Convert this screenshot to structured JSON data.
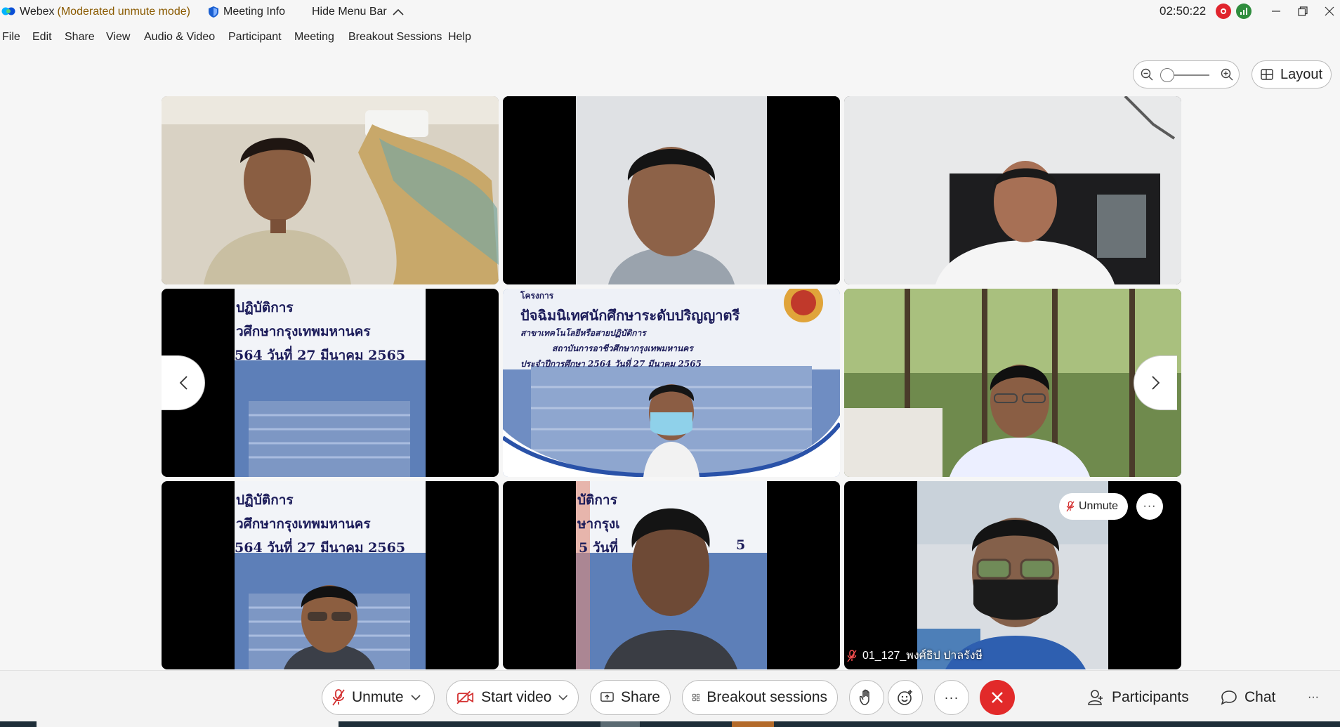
{
  "titlebar": {
    "app": "Webex",
    "mode": "(Moderated unmute mode)",
    "meeting_info": "Meeting Info",
    "hide_menu": "Hide Menu Bar",
    "time": "02:50:22"
  },
  "menu": [
    "File",
    "Edit",
    "Share",
    "View",
    "Audio & Video",
    "Participant",
    "Meeting",
    "Breakout Sessions",
    "Help"
  ],
  "view": {
    "layout_label": "Layout"
  },
  "tiles": {
    "t4_lines": [
      "ปฏิบัติการ",
      "วศึกษากรุงเทพมหานคร",
      "564 วันที่ 27 มีนาคม 2565"
    ],
    "t5_lines": [
      "โครงการ",
      "ปัจฉิมนิเทศนักศึกษาระดับปริญญาตรี",
      "สาขาเทคโนโลยีหรือสายปฏิบัติการ",
      "สถาบันการอาชีวศึกษากรุงเทพมหานคร",
      "ประจำปีการศึกษา 2564 วันที่ 27 มีนาคม 2565"
    ],
    "t7_lines": [
      "ปฏิบัติการ",
      "วศึกษากรุงเทพมหานคร",
      "564 วันที่ 27 มีนาคม 2565"
    ],
    "t8_lines": [
      "บัติการ",
      "ษากรุงเ",
      "5 วันที่",
      "5"
    ],
    "t9_unmute": "Unmute",
    "t9_more": "···",
    "t9_name": "01_127_พงศ์ธิป ปาลรังษี"
  },
  "controls": {
    "unmute": "Unmute",
    "start_video": "Start video",
    "share": "Share",
    "breakout": "Breakout sessions",
    "more": "···",
    "participants": "Participants",
    "chat": "Chat",
    "overflow": "···"
  },
  "colors": {
    "accent_red": "#e22a2a",
    "mode_text": "#8a5a00",
    "record": "#e0242d",
    "network": "#2f8d3e"
  }
}
